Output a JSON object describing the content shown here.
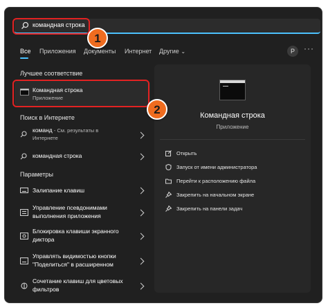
{
  "search": {
    "value_bold": "команд",
    "value_rest": "ная строка"
  },
  "tabs": [
    "Все",
    "Приложения",
    "Документы",
    "Интернет",
    "Другие"
  ],
  "tabs_more_arrow": "⌄",
  "user_initial": "Р",
  "more_glyph": "···",
  "sections": {
    "best_match": "Лучшее соответствие",
    "web": "Поиск в Интернете",
    "settings": "Параметры"
  },
  "best_match": {
    "title": "Командная строка",
    "subtitle": "Приложение"
  },
  "web_results": [
    {
      "title": "команд",
      "title_rest": " - См. результаты в",
      "line2": "Интернете"
    },
    {
      "title": "командная строка",
      "title_rest": "",
      "line2": ""
    }
  ],
  "settings_results": [
    {
      "line1": "Залипание клавиш",
      "line2": ""
    },
    {
      "line1": "Управление псевдонимами",
      "line2": "выполнения приложения"
    },
    {
      "line1": "Блокировка клавиши экранного",
      "line2": "диктора"
    },
    {
      "line1": "Управлять видимостью кнопки",
      "line2": "\"Поделиться\" в расширенном"
    },
    {
      "line1": "Сочетание клавиш для цветовых",
      "line2": "фильтров"
    }
  ],
  "details": {
    "title": "Командная строка",
    "subtitle": "Приложение",
    "actions": [
      "Открыть",
      "Запуск от имени администратора",
      "Перейти к расположению файла",
      "Закрепить на начальном экране",
      "Закрепить на панели задач"
    ]
  },
  "badges": [
    "1",
    "2"
  ],
  "colors": {
    "accent": "#4cc2ff",
    "callout": "#e32222",
    "badge": "#ef6c1f"
  }
}
